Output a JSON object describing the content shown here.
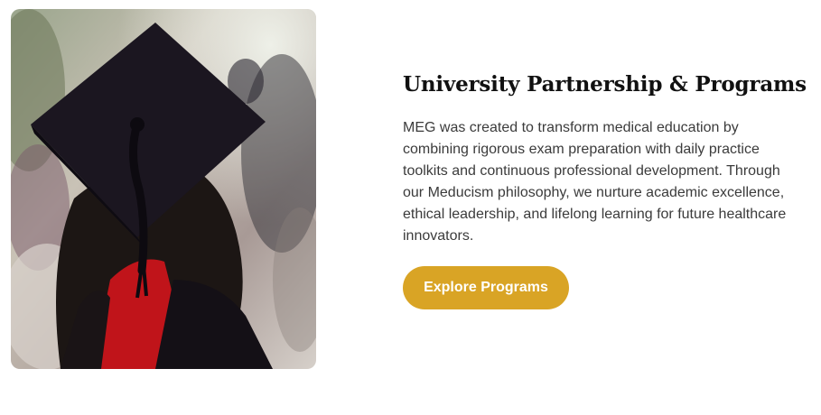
{
  "section": {
    "title": "University Partnership & Programs",
    "description": "MEG was created to transform medical education by combining rigorous exam preparation with daily practice toolkits and continuous professional development. Through our Meducism philosophy, we nurture academic excellence, ethical leadership, and lifelong learning for future healthcare innovators.",
    "cta_label": "Explore Programs"
  },
  "colors": {
    "accent": "#d9a425",
    "heading": "#111111",
    "body_text": "#3b3b3b"
  }
}
